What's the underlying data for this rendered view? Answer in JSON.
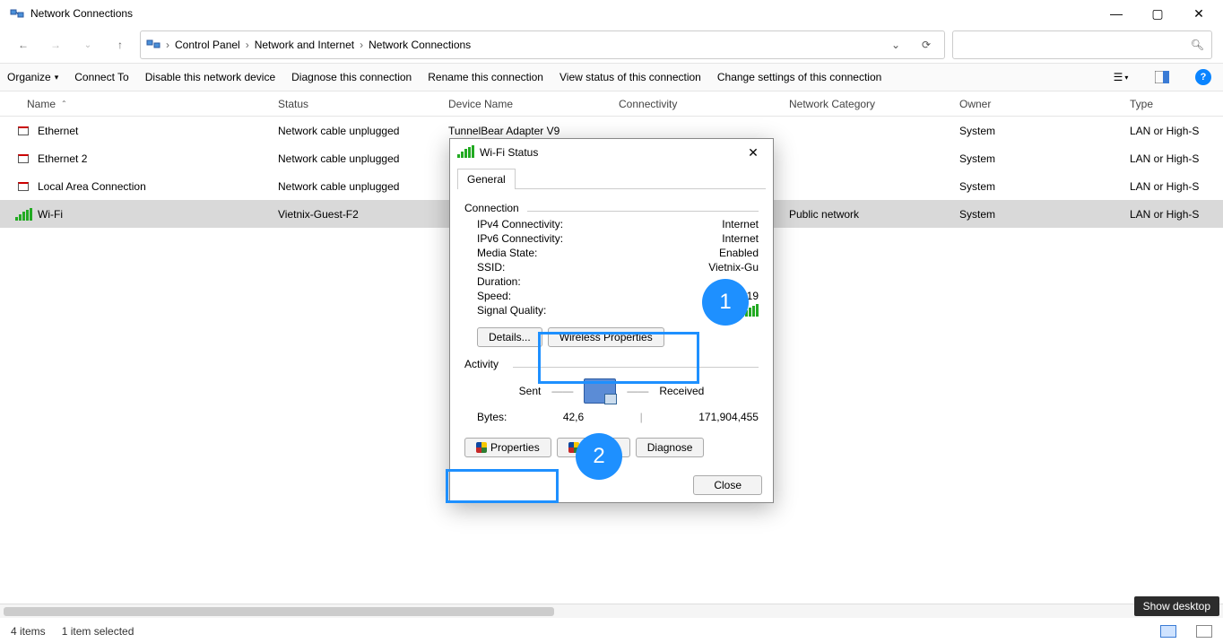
{
  "window": {
    "title": "Network Connections"
  },
  "breadcrumbs": {
    "root": "Control Panel",
    "mid": "Network and Internet",
    "leaf": "Network Connections"
  },
  "toolbar": {
    "organize": "Organize",
    "connect": "Connect To",
    "disable": "Disable this network device",
    "diagnose": "Diagnose this connection",
    "rename": "Rename this connection",
    "viewstatus": "View status of this connection",
    "changeset": "Change settings of this connection"
  },
  "columns": {
    "name": "Name",
    "status": "Status",
    "device": "Device Name",
    "connectivity": "Connectivity",
    "category": "Network Category",
    "owner": "Owner",
    "type": "Type"
  },
  "rows": [
    {
      "name": "Ethernet",
      "status": "Network cable unplugged",
      "device": "TunnelBear Adapter V9",
      "connectivity": "",
      "category": "",
      "owner": "System",
      "type": "LAN or High-S"
    },
    {
      "name": "Ethernet 2",
      "status": "Network cable unplugged",
      "device": "",
      "connectivity": "",
      "category": "",
      "owner": "System",
      "type": "LAN or High-S"
    },
    {
      "name": "Local Area Connection",
      "status": "Network cable unplugged",
      "device": "",
      "connectivity": "",
      "category": "",
      "owner": "System",
      "type": "LAN or High-S"
    },
    {
      "name": "Wi-Fi",
      "status": "Vietnix-Guest-F2",
      "device": "",
      "connectivity": "",
      "category": "Public network",
      "owner": "System",
      "type": "LAN or High-S"
    }
  ],
  "dialog": {
    "title": "Wi-Fi Status",
    "tab": "General",
    "section_connection": "Connection",
    "ipv4_k": "IPv4 Connectivity:",
    "ipv4_v": "Internet",
    "ipv6_k": "IPv6 Connectivity:",
    "ipv6_v": "Internet",
    "media_k": "Media State:",
    "media_v": "Enabled",
    "ssid_k": "SSID:",
    "ssid_v": "Vietnix-Gu",
    "duration_k": "Duration:",
    "duration_v": "",
    "speed_k": "Speed:",
    "speed_v": "19",
    "signal_k": "Signal Quality:",
    "details_btn": "Details...",
    "wprops_btn": "Wireless Properties",
    "section_activity": "Activity",
    "sent_label": "Sent",
    "received_label": "Received",
    "bytes_label": "Bytes:",
    "bytes_sent": "42,6",
    "bytes_recv": "171,904,455",
    "properties_btn": "Properties",
    "disable_btn": "Disable",
    "diagnose_btn": "Diagnose",
    "close_btn": "Close"
  },
  "statusbar": {
    "count": "4 items",
    "selected": "1 item selected"
  },
  "tooltip": {
    "showdesktop": "Show desktop"
  },
  "annotations": {
    "b1": "1",
    "b2": "2"
  }
}
